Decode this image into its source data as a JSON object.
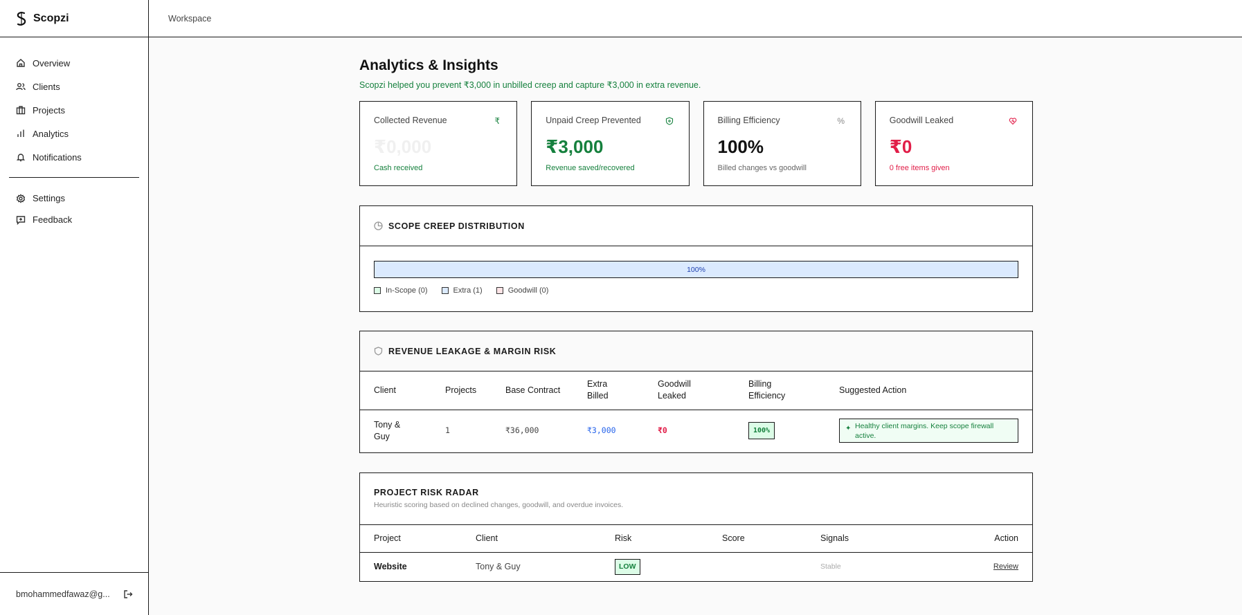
{
  "app": {
    "name": "Scopzi"
  },
  "header": {
    "breadcrumb": "Workspace"
  },
  "sidebar": {
    "items": [
      {
        "label": "Overview",
        "icon": "home-icon"
      },
      {
        "label": "Clients",
        "icon": "users-icon"
      },
      {
        "label": "Projects",
        "icon": "briefcase-icon"
      },
      {
        "label": "Analytics",
        "icon": "bar-chart-icon"
      },
      {
        "label": "Notifications",
        "icon": "bell-icon"
      }
    ],
    "secondary": [
      {
        "label": "Settings",
        "icon": "gear-icon"
      },
      {
        "label": "Feedback",
        "icon": "feedback-icon"
      }
    ],
    "user_email": "bmohammedfawaz@g..."
  },
  "page": {
    "title": "Analytics & Insights",
    "subtitle": "Scopzi helped you prevent ₹3,000 in unbilled creep and capture ₹3,000 in extra revenue."
  },
  "cards": [
    {
      "label": "Collected Revenue",
      "icon": "₹",
      "value": "₹0,000",
      "caption": "Cash received"
    },
    {
      "label": "Unpaid Creep Prevented",
      "icon": "shield",
      "value": "₹3,000",
      "caption": "Revenue saved/recovered"
    },
    {
      "label": "Billing Efficiency",
      "icon": "%",
      "value": "100%",
      "caption": "Billed changes vs goodwill"
    },
    {
      "label": "Goodwill Leaked",
      "icon": "heart",
      "value": "₹0",
      "caption": "0 free items given"
    }
  ],
  "distribution": {
    "title": "SCOPE CREEP DISTRIBUTION",
    "bar_label": "100%",
    "extra_share": 1.0,
    "legend": [
      {
        "label": "In-Scope (0)",
        "color": "#dcfce7"
      },
      {
        "label": "Extra (1)",
        "color": "#dbeafe"
      },
      {
        "label": "Goodwill (0)",
        "color": "#ffe4e6"
      }
    ]
  },
  "leakage": {
    "title": "REVENUE LEAKAGE & MARGIN RISK",
    "columns": [
      "Client",
      "Projects",
      "Base Contract",
      "Extra Billed",
      "Goodwill Leaked",
      "Billing Efficiency",
      "Suggested Action"
    ],
    "rows": [
      {
        "client": "Tony & Guy",
        "projects": "1",
        "base": "₹36,000",
        "extra": "₹3,000",
        "goodwill": "₹0",
        "efficiency": "100%",
        "action": "Healthy client margins. Keep scope firewall active."
      }
    ]
  },
  "radar": {
    "title": "PROJECT RISK RADAR",
    "description": "Heuristic scoring based on declined changes, goodwill, and overdue invoices.",
    "columns": [
      "Project",
      "Client",
      "Risk",
      "Score",
      "Signals",
      "Action"
    ],
    "rows": [
      {
        "project": "Website",
        "client": "Tony & Guy",
        "risk": "LOW",
        "score": "",
        "signals": "Stable",
        "action": "Review"
      }
    ]
  },
  "colors": {
    "green": "#15803d",
    "pink": "#e11d48",
    "blue": "#1e40af"
  }
}
